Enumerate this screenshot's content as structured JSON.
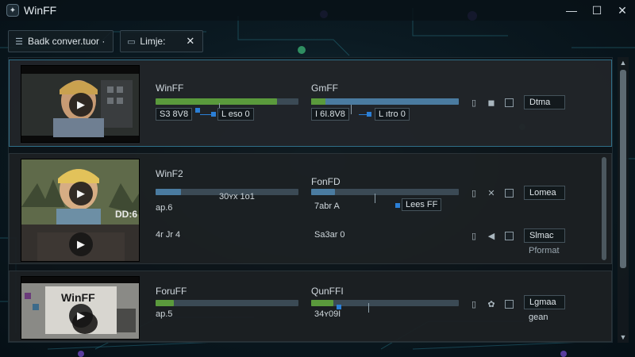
{
  "window": {
    "title": "WinFF",
    "logo_glyph": "✦"
  },
  "window_controls": {
    "minimize": "—",
    "maximize": "☐",
    "close": "✕"
  },
  "tabs": [
    {
      "label": "Badk conver.tuor ·",
      "icon": "☰"
    },
    {
      "label": "Limje:",
      "icon": "▭",
      "close": "✕"
    }
  ],
  "rows": [
    {
      "col1_title": "WinFF",
      "col1_progress": 0.85,
      "col1_size": "S3 8V8",
      "col1_bitrate": "L eso 0",
      "col2_title": "GmFF",
      "col2_progress": 1.0,
      "col2_size": "I 6I.8V8",
      "col2_bitrate": "L ıtro 0",
      "format": "Dtma",
      "format_extra": ""
    },
    {
      "thumb_label": "DD:6",
      "col1_title": "WinF2",
      "col1_progress": 0.18,
      "col1_size": "ap.6",
      "col1_bitrate": "30ʏx 1o1",
      "col2_title": "FonFD",
      "col2_progress": 0.16,
      "col2_size": "7abr A",
      "col2_bitrate": "Lees FF",
      "format": "Lomea",
      "format_extra": ""
    },
    {
      "col1_title": "4r Jr 4",
      "col1_progress": null,
      "col1_size": "",
      "col1_bitrate": "",
      "col2_title": "Sa3ar 0",
      "col2_progress": null,
      "col2_size": "",
      "col2_bitrate": "",
      "format": "Slmac",
      "format_extra": "Pformat"
    },
    {
      "thumb_label": "WinFF",
      "col1_title": "ForuFF",
      "col1_progress": 0.13,
      "col1_size": "ap.5",
      "col1_bitrate": "",
      "col2_title": "QunFFI",
      "col2_progress": 0.15,
      "col2_size": "34ʏ09I",
      "col2_bitrate": "",
      "format": "Lgmaa",
      "format_extra": "gean"
    }
  ],
  "colors": {
    "accent": "#2f6f88",
    "progress_fill": "#5a9a3c",
    "blue_fill": "#4a7ba0",
    "marker": "#2b7fd6"
  },
  "icons": [
    "film-icon",
    "gear-icon",
    "check-icon"
  ]
}
